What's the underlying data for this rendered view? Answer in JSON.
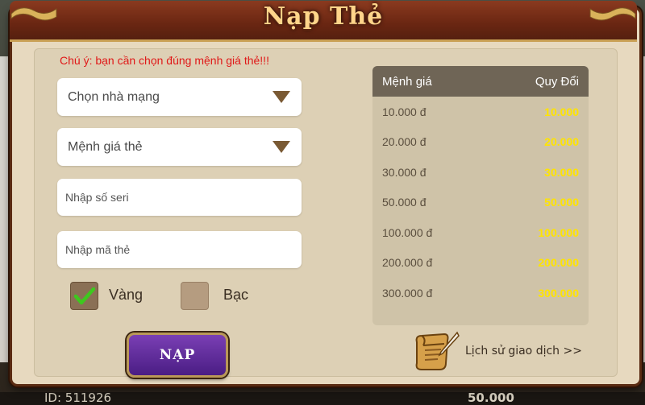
{
  "modal": {
    "title": "Nạp Thẻ",
    "warning": "Chú ý: bạn cần chọn đúng mệnh giá thẻ!!!"
  },
  "form": {
    "carrier_select": "Chọn nhà mạng",
    "value_select": "Mệnh giá thẻ",
    "serial_placeholder": "Nhập số seri",
    "code_placeholder": "Nhập mã thẻ",
    "options": [
      {
        "label": "Vàng",
        "checked": true
      },
      {
        "label": "Bạc",
        "checked": false
      }
    ],
    "submit_label": "NẠP"
  },
  "price_table": {
    "headers": [
      "Mệnh giá",
      "Quy Đổi"
    ],
    "rows": [
      {
        "value": "10.000 đ",
        "convert": "10.000"
      },
      {
        "value": "20.000 đ",
        "convert": "20.000"
      },
      {
        "value": "30.000 đ",
        "convert": "30.000"
      },
      {
        "value": "50.000 đ",
        "convert": "50.000"
      },
      {
        "value": "100.000 đ",
        "convert": "100.000"
      },
      {
        "value": "200.000 đ",
        "convert": "200.000"
      },
      {
        "value": "300.000 đ",
        "convert": "300.000"
      }
    ]
  },
  "history": {
    "label": "Lịch sử giao dịch >>"
  },
  "background": {
    "id_text": "ID: 511926",
    "amount_text": "50.000"
  },
  "colors": {
    "accent_yellow": "#ffe400",
    "warning_red": "#e01818",
    "button_purple": "#4a1d84"
  }
}
